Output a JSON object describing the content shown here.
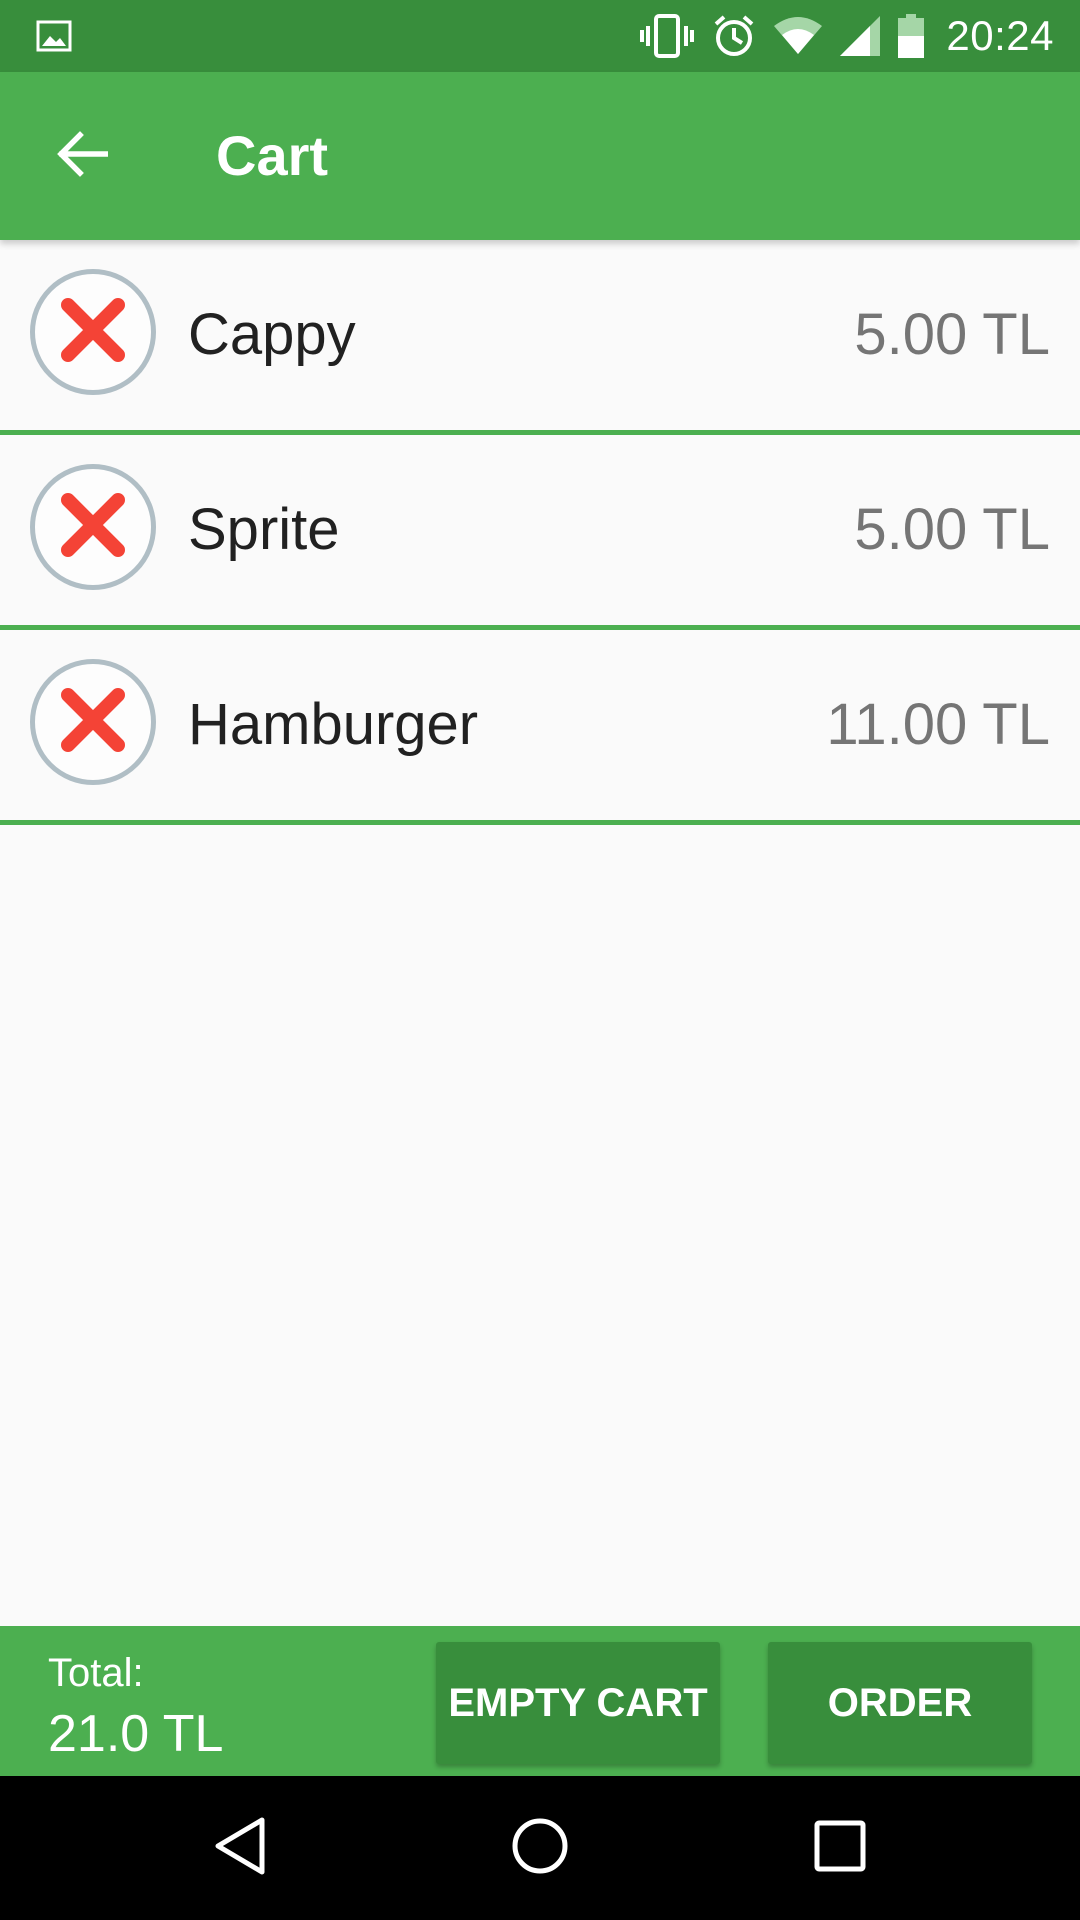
{
  "status_bar": {
    "time": "20:24",
    "icons": [
      "image-notification-icon",
      "vibrate-icon",
      "alarm-icon",
      "wifi-icon",
      "cell-signal-icon",
      "battery-icon"
    ]
  },
  "app_bar": {
    "title": "Cart",
    "back_icon": "arrow-back-icon"
  },
  "cart": {
    "items": [
      {
        "name": "Cappy",
        "price": "5.00 TL"
      },
      {
        "name": "Sprite",
        "price": "5.00 TL"
      },
      {
        "name": "Hamburger",
        "price": "11.00 TL"
      }
    ],
    "remove_icon": "remove-x-icon"
  },
  "summary": {
    "total_label": "Total:",
    "total_value": "21.0 TL",
    "empty_cart_label": "EMPTY CART",
    "order_label": "ORDER"
  },
  "nav_bar": {
    "icons": [
      "nav-back-icon",
      "nav-home-icon",
      "nav-recents-icon"
    ]
  },
  "colors": {
    "primary": "#4caf50",
    "primary_dark": "#388e3c",
    "remove_red": "#f44336",
    "price_gray": "#757575"
  }
}
